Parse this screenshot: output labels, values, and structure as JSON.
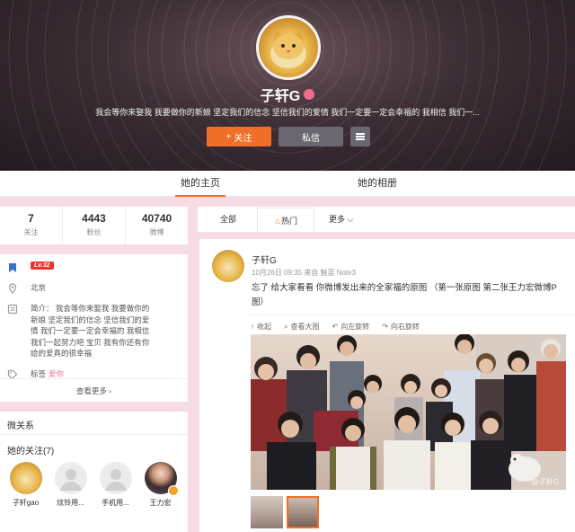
{
  "profile": {
    "name": "子轩G",
    "bio": "我会等你来娶我 我要做你的新娘 坚定我们的信念 坚信我们的爱情 我们一定要一定会幸福的 我相信 我们一...",
    "follow_label": "关注",
    "message_label": "私信"
  },
  "tabs": {
    "home": "她的主页",
    "album": "她的相册"
  },
  "stats": [
    {
      "num": "7",
      "label": "关注"
    },
    {
      "num": "4443",
      "label": "粉丝"
    },
    {
      "num": "40740",
      "label": "微博"
    }
  ],
  "info": {
    "level_badge": "Lv.32",
    "location": "北京",
    "intro": "简介： 我会等你来娶我 我要做你的新娘 坚定我们的信念 坚信我们的爱情 我们一定要一定会幸福的 我相信 我们一起努力吧 宝贝 我有你还有你给的爱真的很幸福",
    "tag_label": "标签",
    "tag_value": "爱你",
    "view_more": "查看更多 ›"
  },
  "relations": {
    "title": "微关系",
    "subtitle": "她的关注(7)",
    "items": [
      {
        "name": "子轩gao"
      },
      {
        "name": "炫铃用..."
      },
      {
        "name": "手机用..."
      },
      {
        "name": "王力宏"
      }
    ]
  },
  "feed_tabs": {
    "all": "全部",
    "hot": "热门",
    "more": "更多 ⌵"
  },
  "post": {
    "author": "子轩G",
    "meta": "10月26日 09:35 来自 魅蓝 Note3",
    "text": "忘了 给大家看看 你微博发出来的全家福的原图 （第一张原图 第二张王力宏微博P图）",
    "tools": {
      "collapse": "收起",
      "view_large": "查看大图",
      "rotate_left": "向左旋转",
      "rotate_right": "向右旋转"
    },
    "watermark": "@子轩G"
  },
  "colors": {
    "accent": "#f0702a",
    "page_bg": "#f7dbe6",
    "banner": "#2c2126"
  }
}
